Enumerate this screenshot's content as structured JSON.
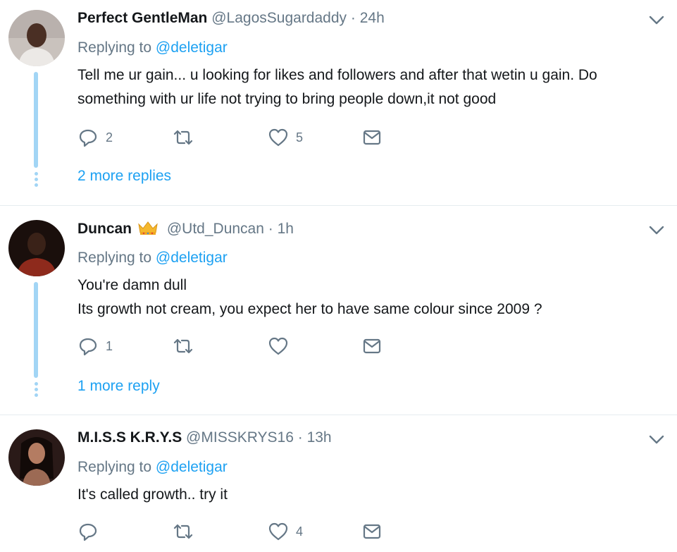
{
  "tweets": [
    {
      "name": "Perfect GentleMan",
      "handle": "@LagosSugardaddy",
      "separator": "·",
      "time": "24h",
      "replying_prefix": "Replying to",
      "replying_to": "@deletigar",
      "body_lines": [
        "Tell me ur gain... u looking for likes and followers and after that wetin u gain. Do",
        "something with ur life not trying to bring people down,it not good"
      ],
      "reply_count": "2",
      "retweet_count": "",
      "like_count": "5",
      "more_replies": "2 more replies"
    },
    {
      "name": "Duncan",
      "name_badge": "crown-emoji",
      "handle": "@Utd_Duncan",
      "separator": "·",
      "time": "1h",
      "replying_prefix": "Replying to",
      "replying_to": "@deletigar",
      "body_lines": [
        "You're damn dull",
        "Its growth not cream, you expect her to have same colour since 2009 ?"
      ],
      "reply_count": "1",
      "retweet_count": "",
      "like_count": "",
      "more_replies": "1 more reply"
    },
    {
      "name": "M.I.S.S K.R.Y.S",
      "handle": "@MISSKRYS16",
      "separator": "·",
      "time": "13h",
      "replying_prefix": "Replying to",
      "replying_to": "@deletigar",
      "body_lines": [
        "It's called growth.. try it"
      ],
      "reply_count": "",
      "retweet_count": "",
      "like_count": "4"
    }
  ],
  "icons": {
    "reply": "reply-icon",
    "retweet": "retweet-icon",
    "like": "heart-icon",
    "dm": "envelope-icon",
    "caret": "chevron-down-icon"
  },
  "colors": {
    "link": "#1da1f2",
    "muted": "#657786",
    "thread_line": "#a2d5f5",
    "divider": "#e6ecf0"
  }
}
